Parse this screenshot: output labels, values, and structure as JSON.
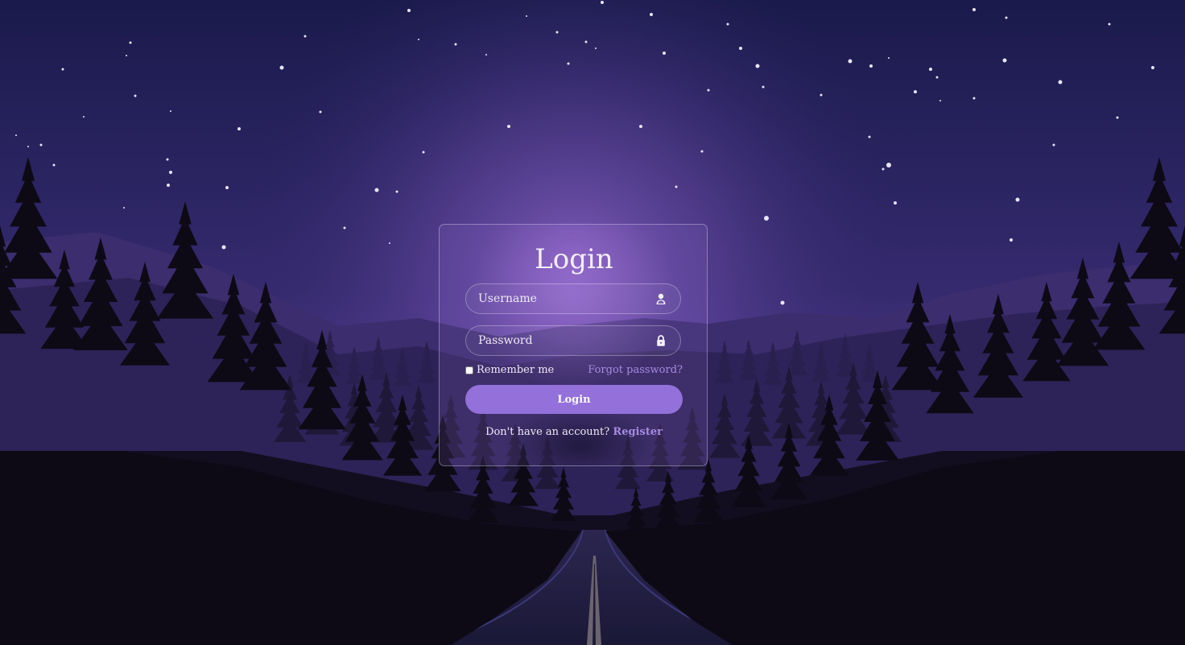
{
  "login_form": {
    "title": "Login",
    "username_placeholder": "Username",
    "password_placeholder": "Password",
    "remember_label": "Remember me",
    "forgot_label": "Forgot password?",
    "submit_label": "Login",
    "register_prompt": "Don't have an account?",
    "register_label": "Register"
  },
  "icons": {
    "username": "user-icon",
    "password": "lock-icon"
  },
  "colors": {
    "sky_top": "#1c1a4e",
    "sky_glow": "#6a4fa8",
    "accent": "#9470da",
    "link": "#a58be0",
    "forest": "#0d0a16"
  }
}
